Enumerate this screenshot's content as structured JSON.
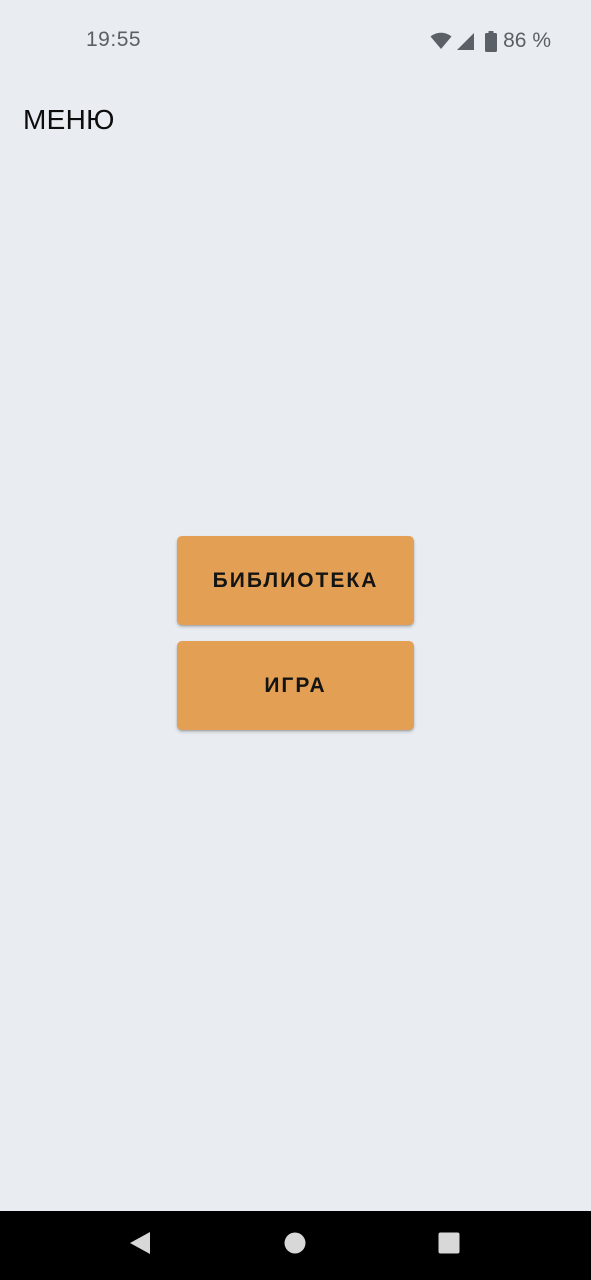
{
  "status_bar": {
    "time": "19:55",
    "battery": "86 %",
    "icons": [
      "wifi-icon",
      "cell-signal-icon",
      "battery-icon"
    ]
  },
  "header": {
    "title": "МЕНЮ"
  },
  "menu": {
    "buttons": [
      {
        "label": "БИБЛИОТЕКА"
      },
      {
        "label": "ИГРА"
      }
    ]
  },
  "nav_bar": {
    "icons": [
      "back-icon",
      "home-icon",
      "recents-icon"
    ]
  },
  "colors": {
    "background": "#e9edf1",
    "button": "#e3a054",
    "nav_bar": "#000000",
    "status_text": "#5b6066"
  }
}
